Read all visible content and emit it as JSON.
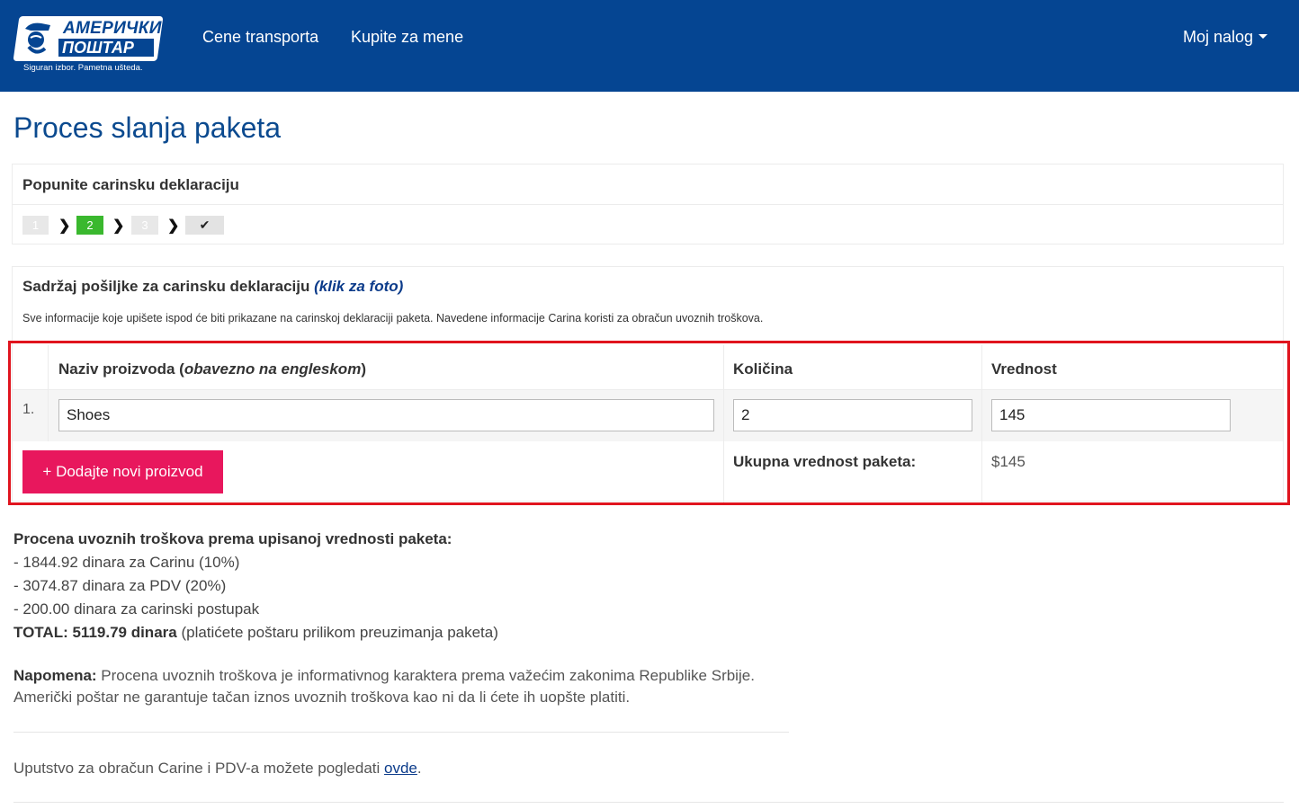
{
  "navbar": {
    "logo": {
      "line1": "АМЕРИЧКИ",
      "line2": "ПОШТАР",
      "tagline": "Siguran izbor. Pametna ušteda."
    },
    "links": [
      "Cene transporta",
      "Kupite za mene"
    ],
    "account_label": "Moj nalog",
    "background": "#054592"
  },
  "page": {
    "title": "Proces slanja paketa"
  },
  "steps_panel": {
    "heading": "Popunite carinsku deklaraciju",
    "steps": [
      "1",
      "2",
      "3",
      "✔"
    ],
    "active_step": "2",
    "active_color": "#3ab82e"
  },
  "declaration": {
    "heading_text": "Sadržaj pošiljke za carinsku deklaraciju ",
    "heading_link": "(klik za foto)",
    "description": "Sve informacije koje upišete ispod će biti prikazane na carinskoj deklaraciji paketa. Navedene informacije Carina koristi za obračun uvoznih troškova.",
    "columns": {
      "name_label": "Naziv proizvoda (",
      "name_hint": "obavezno na engleskom",
      "name_close": ")",
      "quantity": "Količina",
      "value": "Vrednost"
    },
    "rows": [
      {
        "num": "1.",
        "name": "Shoes",
        "quantity": "2",
        "value": "145"
      }
    ],
    "add_button": "+ Dodajte novi proizvod",
    "add_button_color": "#e8175d",
    "total_label": "Ukupna vrednost paketa:",
    "total_value": "$145"
  },
  "estimate": {
    "heading": "Procena uvoznih troškova prema upisanoj vrednosti paketa:",
    "lines": [
      "- 1844.92 dinara za Carinu (10%)",
      "- 3074.87 dinara za PDV (20%)",
      "- 200.00 dinara za carinski postupak"
    ],
    "total_bold": "TOTAL: 5119.79 dinara",
    "total_rest": " (platićete poštaru prilikom preuzimanja paketa)"
  },
  "note": {
    "label": "Napomena:",
    "line1": " Procena uvoznih troškova je informativnog karaktera prema važećim zakonima Republike Srbije.",
    "line2": "Američki poštar ne garantuje tačan iznos uvoznih troškova kao ni da li ćete ih uopšte platiti."
  },
  "guide": {
    "text": "Uputstvo za obračun Carine i PDV-a možete pogledati ",
    "link": "ovde",
    "end": "."
  }
}
